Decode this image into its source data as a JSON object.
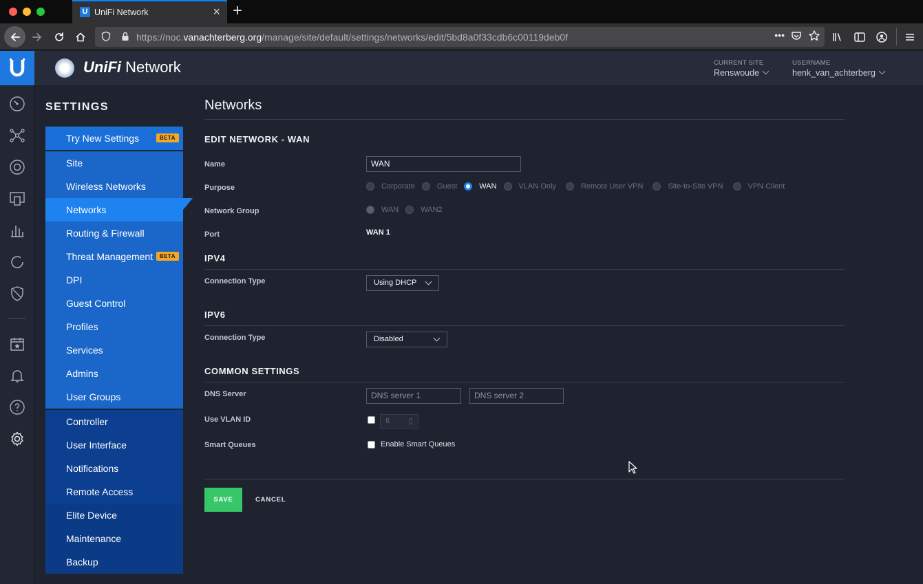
{
  "browser": {
    "tab_title": "UniFi Network",
    "tab_favicon": "U",
    "url_prefix": "https://noc.",
    "url_host": "vanachterberg.org",
    "url_path": "/manage/site/default/settings/networks/edit/5bd8a0f33cdb6c00119deb0f"
  },
  "header": {
    "brand_italic": "UniFi",
    "brand_rest": " Network",
    "site_label": "CURRENT SITE",
    "site_value": "Renswoude",
    "user_label": "USERNAME",
    "user_value": "henk_van_achterberg"
  },
  "sidebar": {
    "heading": "SETTINGS",
    "top_item": {
      "label": "Try New Settings",
      "badge": "BETA"
    },
    "items": [
      {
        "label": "Site"
      },
      {
        "label": "Wireless Networks"
      },
      {
        "label": "Networks",
        "active": true
      },
      {
        "label": "Routing & Firewall"
      },
      {
        "label": "Threat Management",
        "badge": "BETA"
      },
      {
        "label": "DPI"
      },
      {
        "label": "Guest Control"
      },
      {
        "label": "Profiles"
      },
      {
        "label": "Services"
      },
      {
        "label": "Admins"
      },
      {
        "label": "User Groups"
      }
    ],
    "lower_items": [
      {
        "label": "Controller"
      },
      {
        "label": "User Interface"
      },
      {
        "label": "Notifications"
      },
      {
        "label": "Remote Access"
      },
      {
        "label": "Elite Device"
      },
      {
        "label": "Maintenance"
      },
      {
        "label": "Backup"
      }
    ]
  },
  "page": {
    "title": "Networks",
    "edit_title": "EDIT NETWORK - WAN",
    "name_label": "Name",
    "name_value": "WAN",
    "purpose_label": "Purpose",
    "purpose_options": [
      "Corporate",
      "Guest",
      "WAN",
      "VLAN Only",
      "Remote User VPN",
      "Site-to-Site VPN",
      "VPN Client"
    ],
    "purpose_selected": "WAN",
    "group_label": "Network Group",
    "group_options": [
      "WAN",
      "WAN2"
    ],
    "port_label": "Port",
    "port_value": "WAN 1",
    "ipv4_title": "IPV4",
    "ipv4_conn_label": "Connection Type",
    "ipv4_conn_value": "Using DHCP",
    "ipv6_title": "IPV6",
    "ipv6_conn_label": "Connection Type",
    "ipv6_conn_value": "Disabled",
    "common_title": "COMMON SETTINGS",
    "dns_label": "DNS Server",
    "dns1_placeholder": "DNS server 1",
    "dns2_placeholder": "DNS server 2",
    "vlan_label": "Use VLAN ID",
    "vlan_value": "6",
    "smartq_label": "Smart Queues",
    "smartq_text": "Enable Smart Queues",
    "save_label": "SAVE",
    "cancel_label": "CANCEL"
  },
  "colors": {
    "accent": "#1e82f0",
    "save": "#38c768",
    "badge": "#f5a623"
  }
}
